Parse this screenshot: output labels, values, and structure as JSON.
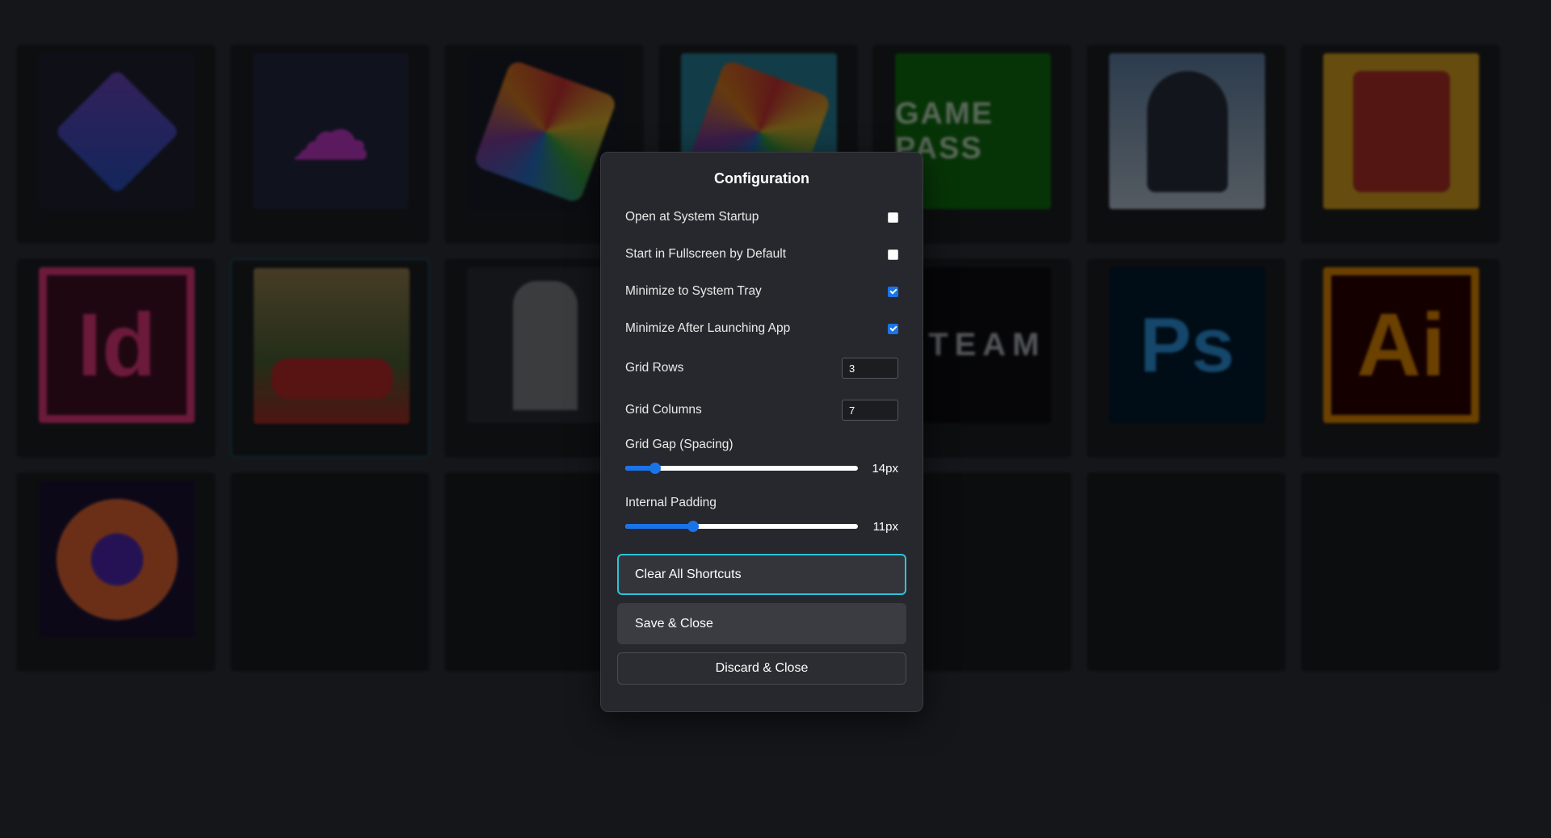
{
  "modal": {
    "title": "Configuration",
    "options": [
      {
        "label": "Open at System Startup",
        "checked": false
      },
      {
        "label": "Start in Fullscreen by Default",
        "checked": false
      },
      {
        "label": "Minimize to System Tray",
        "checked": true
      },
      {
        "label": "Minimize After Launching App",
        "checked": true
      }
    ],
    "grid_rows": {
      "label": "Grid Rows",
      "value": "3"
    },
    "grid_columns": {
      "label": "Grid Columns",
      "value": "7"
    },
    "grid_gap": {
      "label": "Grid Gap (Spacing)",
      "value_text": "14px",
      "fraction": 0.13
    },
    "internal_padding": {
      "label": "Internal Padding",
      "value_text": "11px",
      "fraction": 0.29
    },
    "buttons": {
      "clear": "Clear All Shortcuts",
      "save": "Save & Close",
      "discard": "Discard & Close"
    }
  },
  "grid": {
    "tiles": [
      {
        "icon": "stremio-icon",
        "glyph": "",
        "style": "stremio"
      },
      {
        "icon": "cloudmoe-icon",
        "glyph": "☁",
        "style": "cloud"
      },
      {
        "icon": "rubiks-cube-icon",
        "glyph": "",
        "style": "cube"
      },
      {
        "icon": "rubiks-cube-icon",
        "glyph": "",
        "style": "cube2"
      },
      {
        "icon": "xbox-game-pass-icon",
        "glyph": "GAME PASS",
        "style": "gamepass"
      },
      {
        "icon": "game-cover-icon",
        "glyph": "",
        "style": "portrait"
      },
      {
        "icon": "game-cover-icon",
        "glyph": "",
        "style": "yakuza"
      },
      {
        "icon": "indesign-icon",
        "glyph": "Id",
        "style": "id"
      },
      {
        "icon": "forza-cover-icon",
        "glyph": "",
        "style": "forza",
        "selected": true
      },
      {
        "icon": "game-cover-icon",
        "glyph": "",
        "style": "dark"
      },
      {
        "icon": "",
        "glyph": "",
        "style": "empty"
      },
      {
        "icon": "steam-icon",
        "glyph": "STEAM",
        "style": "steam"
      },
      {
        "icon": "photoshop-icon",
        "glyph": "Ps",
        "style": "ps"
      },
      {
        "icon": "illustrator-icon",
        "glyph": "Ai",
        "style": "ai"
      },
      {
        "icon": "firefox-icon",
        "glyph": "",
        "style": "firefox"
      },
      {
        "icon": "",
        "glyph": "",
        "style": "empty"
      },
      {
        "icon": "",
        "glyph": "",
        "style": "empty"
      },
      {
        "icon": "",
        "glyph": "",
        "style": "empty"
      },
      {
        "icon": "",
        "glyph": "",
        "style": "empty"
      },
      {
        "icon": "",
        "glyph": "",
        "style": "empty"
      },
      {
        "icon": "",
        "glyph": "",
        "style": "empty"
      }
    ]
  },
  "colors": {
    "accent": "#1a73e8",
    "focus_border": "#2cc3d9",
    "modal_bg": "#26282d",
    "page_bg": "#15161a"
  }
}
